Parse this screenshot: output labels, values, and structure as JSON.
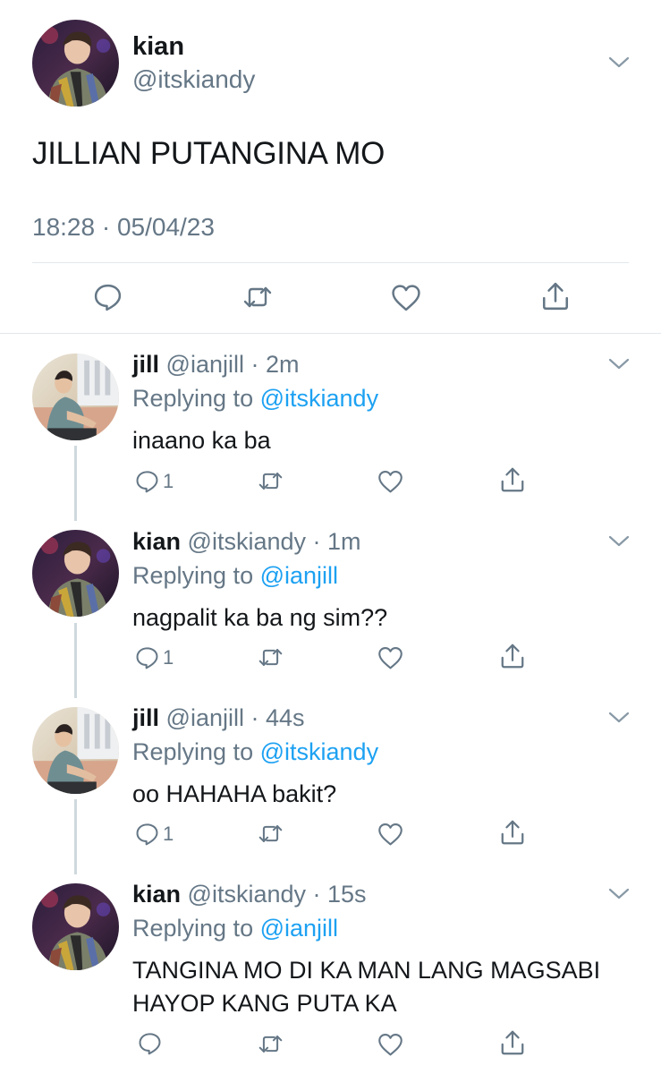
{
  "main_tweet": {
    "name": "kian",
    "handle": "@itskiandy",
    "text": "JILLIAN PUTANGINA MO",
    "timestamp": "18:28 · 05/04/23",
    "actions": [
      "reply-icon",
      "retweet-icon",
      "like-icon",
      "share-icon"
    ]
  },
  "replies": [
    {
      "name": "jill",
      "handle": "@ianjill",
      "time": "2m",
      "replying_prefix": "Replying to",
      "replying_to": "@itskiandy",
      "text_lines": [
        "inaano ka ba"
      ],
      "reply_count": "1"
    },
    {
      "name": "kian",
      "handle": "@itskiandy",
      "time": "1m",
      "replying_prefix": "Replying to",
      "replying_to": "@ianjill",
      "text_lines": [
        "nagpalit ka ba ng sim??"
      ],
      "reply_count": "1"
    },
    {
      "name": "jill",
      "handle": "@ianjill",
      "time": "44s",
      "replying_prefix": "Replying to",
      "replying_to": "@itskiandy",
      "text_lines": [
        "oo HAHAHA bakit?"
      ],
      "reply_count": "1"
    },
    {
      "name": "kian",
      "handle": "@itskiandy",
      "time": "15s",
      "replying_prefix": "Replying to",
      "replying_to": "@ianjill",
      "text_lines": [
        "TANGINA MO DI KA MAN LANG MAGSABI",
        "HAYOP KANG PUTA KA"
      ],
      "reply_count": ""
    }
  ],
  "colors": {
    "link": "#1da1f2",
    "secondary_text": "#657786",
    "primary_text": "#14171a",
    "divider": "#e1e8ed"
  }
}
